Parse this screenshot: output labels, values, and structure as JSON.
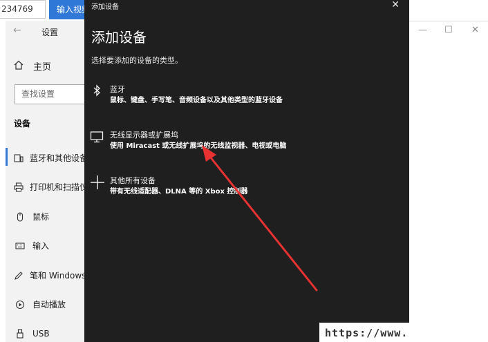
{
  "topbar": {
    "id_value": "234769",
    "blue_button": "输入视频"
  },
  "settings": {
    "title": "设置",
    "home": "主页",
    "search_placeholder": "查找设置",
    "section": "设备",
    "items": [
      {
        "label": "蓝牙和其他设备",
        "icon": "bluetooth-devices-icon"
      },
      {
        "label": "打印机和扫描仪",
        "icon": "printer-icon"
      },
      {
        "label": "鼠标",
        "icon": "mouse-icon"
      },
      {
        "label": "输入",
        "icon": "keyboard-icon"
      },
      {
        "label": "笔和 Windows Ink",
        "icon": "pen-icon"
      },
      {
        "label": "自动播放",
        "icon": "autoplay-icon"
      },
      {
        "label": "USB",
        "icon": "usb-icon"
      }
    ]
  },
  "dialog": {
    "titlebar": "添加设备",
    "heading": "添加设备",
    "subtitle": "选择要添加的设备的类型。",
    "options": [
      {
        "title": "蓝牙",
        "desc": "鼠标、键盘、手写笔、音频设备以及其他类型的蓝牙设备",
        "icon": "bluetooth-icon"
      },
      {
        "title": "无线显示器或扩展坞",
        "desc": "使用 Miracast 或无线扩展坞的无线监视器、电视或电脑",
        "icon": "monitor-icon"
      },
      {
        "title": "其他所有设备",
        "desc": "带有无线适配器、DLNA 等的 Xbox 控制器",
        "icon": "plus-icon"
      }
    ]
  },
  "annotation": {
    "arrow_color": "#e83232"
  },
  "watermark": "https://www."
}
